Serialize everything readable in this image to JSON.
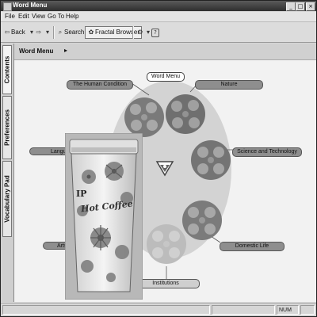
{
  "window": {
    "title": "Word Menu",
    "controls": {
      "minimize": "_",
      "maximize": "□",
      "close": "×"
    }
  },
  "menu": [
    "File",
    "Edit",
    "View",
    "Go To",
    "Help"
  ],
  "toolbar": {
    "back_label": "Back",
    "search_label": "Search",
    "fractal_label": "Fractal Browser"
  },
  "sidebar": {
    "tabs": [
      "Contents",
      "Preferences",
      "Vocabulary Pad"
    ]
  },
  "content": {
    "header_title": "Word Menu"
  },
  "categories": [
    {
      "label": "Word Menu"
    },
    {
      "label": "The Human Condition"
    },
    {
      "label": "Nature"
    },
    {
      "label": "Language"
    },
    {
      "label": "Science and Technology"
    },
    {
      "label": "Arts"
    },
    {
      "label": "Domestic Life"
    },
    {
      "label": "Institutions"
    }
  ],
  "overlay_product": {
    "logo_text": "IP",
    "brand_text": "Hot Coffee"
  },
  "statusbar": {
    "indicator": "NUM"
  },
  "colors": {
    "title_bar": "#3a3a3a",
    "circle": "#d3d3d3",
    "label_pill": "#8e8e8e",
    "fractal_node": "#777777"
  }
}
